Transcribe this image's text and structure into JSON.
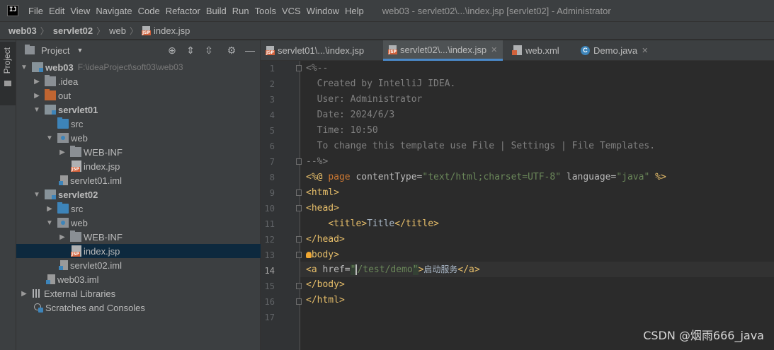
{
  "menubar": {
    "logo": "IJ",
    "items": [
      "File",
      "Edit",
      "View",
      "Navigate",
      "Code",
      "Refactor",
      "Build",
      "Run",
      "Tools",
      "VCS",
      "Window",
      "Help"
    ],
    "window_title": "web03 - servlet02\\...\\index.jsp [servlet02] - Administrator"
  },
  "breadcrumb": [
    "web03",
    "servlet02",
    "web",
    "index.jsp"
  ],
  "left_strip": {
    "label": "Project"
  },
  "project_panel": {
    "title": "Project",
    "tree": [
      {
        "label": "web03",
        "path": "F:\\ideaProject\\soft03\\web03",
        "bold": true
      },
      {
        "label": ".idea"
      },
      {
        "label": "out"
      },
      {
        "label": "servlet01",
        "bold": true
      },
      {
        "label": "src"
      },
      {
        "label": "web"
      },
      {
        "label": "WEB-INF"
      },
      {
        "label": "index.jsp"
      },
      {
        "label": "servlet01.iml"
      },
      {
        "label": "servlet02",
        "bold": true
      },
      {
        "label": "src"
      },
      {
        "label": "web"
      },
      {
        "label": "WEB-INF"
      },
      {
        "label": "index.jsp",
        "selected": true
      },
      {
        "label": "servlet02.iml"
      },
      {
        "label": "web03.iml"
      },
      {
        "label": "External Libraries"
      },
      {
        "label": "Scratches and Consoles"
      }
    ]
  },
  "tabs": [
    {
      "label": "servlet01\\...\\index.jsp",
      "active": false
    },
    {
      "label": "servlet02\\...\\index.jsp",
      "active": true
    },
    {
      "label": "web.xml",
      "active": false
    },
    {
      "label": "Demo.java",
      "active": false
    }
  ],
  "editor": {
    "line_numbers": [
      "1",
      "2",
      "3",
      "4",
      "5",
      "6",
      "7",
      "8",
      "9",
      "10",
      "11",
      "12",
      "13",
      "14",
      "15",
      "16",
      "17"
    ],
    "current_line": "14",
    "lines": {
      "l1": "<%--",
      "l2": "  Created by IntelliJ IDEA.",
      "l3": "  User: Administrator",
      "l4": "  Date: 2024/6/3",
      "l5": "  Time: 10:50",
      "l6": "  To change this template use File | Settings | File Templates.",
      "l7": "--%>",
      "l8_open": "<%@ ",
      "l8_kw": "page",
      "l8_attr1": " contentType=",
      "l8_val1": "\"text/html;charset=UTF-8\"",
      "l8_attr2": " language=",
      "l8_val2": "\"java\"",
      "l8_close": " %>",
      "l9": "<html>",
      "l10": "<head>",
      "l11_indent": "    ",
      "l11_open": "<title>",
      "l11_text": "Title",
      "l11_close": "</title>",
      "l12": "</head>",
      "l13": "<body>",
      "l14_open": "<a ",
      "l14_attr": "href=",
      "l14_q1": "\"",
      "l14_url": "/test/demo",
      "l14_q2": "\"",
      "l14_gt": ">",
      "l14_text": "启动服务",
      "l14_close": "</a>",
      "l15": "</body>",
      "l16": "</html>"
    }
  },
  "watermark": "CSDN @烟雨666_java",
  "colors": {
    "background": "#2b2b2b",
    "panel": "#3c3f41",
    "selection": "#0d293e",
    "tag": "#e8bf6a",
    "string": "#6a8759",
    "keyword": "#cc7832",
    "comment": "#808080",
    "accent": "#4a88c7"
  }
}
